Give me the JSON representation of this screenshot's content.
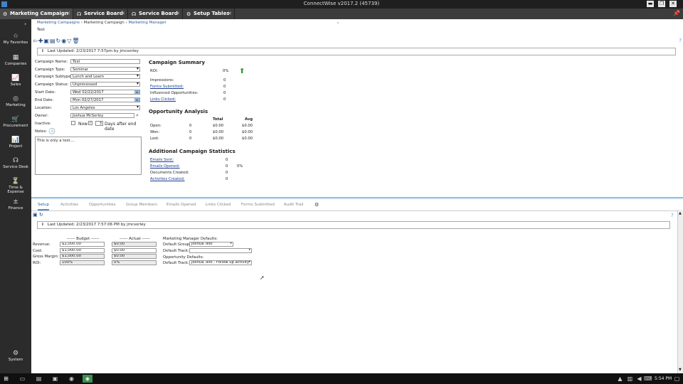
{
  "window": {
    "title": "ConnectWise v2017.2 (45739)",
    "minimize": "▬",
    "restore": "❐",
    "close": "✕"
  },
  "tabs": [
    {
      "label": "Marketing Campaign",
      "icon": "gear-icon"
    },
    {
      "label": "Service Board",
      "icon": "headset-icon"
    },
    {
      "label": "Service Board",
      "icon": "headset-icon"
    },
    {
      "label": "Setup Tables",
      "icon": "gear-icon"
    }
  ],
  "nav": [
    {
      "label": "My Favorites",
      "icon": "star-icon"
    },
    {
      "label": "Companies",
      "icon": "building-icon"
    },
    {
      "label": "Sales",
      "icon": "chart-icon"
    },
    {
      "label": "Marketing",
      "icon": "target-icon"
    },
    {
      "label": "Procurement",
      "icon": "cart-icon"
    },
    {
      "label": "Project",
      "icon": "project-icon"
    },
    {
      "label": "Service Desk",
      "icon": "headset-icon"
    },
    {
      "label": "Time & Expense",
      "icon": "time-icon"
    },
    {
      "label": "Finance",
      "icon": "finance-icon"
    },
    {
      "label": "System",
      "icon": "gear-icon"
    }
  ],
  "breadcrumb": {
    "c1": "Marketing Campaigns",
    "c2": "Marketing Campaign",
    "c3": "Marketing Manager",
    "sep": "›"
  },
  "subtitle": "Test",
  "info_top": "Last Updated: 2/23/2017 7:57pm by jmcsorley",
  "form": {
    "name_label": "Campaign Name:",
    "name": "Test",
    "type_label": "Campaign Type:",
    "type": "Seminar",
    "subtype_label": "Campaign Subtype:",
    "subtype": "Lunch and Learn",
    "status_label": "Campaign Status:",
    "status": "Unprocessed",
    "start_label": "Start Date:",
    "start": "Wed 02/22/2017",
    "end_label": "End Date:",
    "end": "Mon 02/27/2017",
    "location_label": "Location:",
    "location": "Los Angeles",
    "owner_label": "Owner:",
    "owner": "Joshua McSorley",
    "inactive_label": "Inactive:",
    "now_label": "Now",
    "days": "3",
    "days_label": "Days after end date",
    "notes_label": "Notes:",
    "notes": "This is only a test...."
  },
  "summary": {
    "title": "Campaign Summary",
    "roi_label": "ROI:",
    "roi": "0%",
    "impressions_label": "Impressions:",
    "impressions": "0",
    "forms_label": "Forms Submitted:",
    "forms": "0",
    "influenced_label": "Influenced Opportunities:",
    "influenced": "0",
    "links_label": "Links Clicked:",
    "links": "0"
  },
  "opportunity": {
    "title": "Opportunity Analysis",
    "h_total": "Total",
    "h_avg": "Avg",
    "rows": [
      {
        "label": "Open:",
        "count": "0",
        "total": "$0.00",
        "avg": "$0.00"
      },
      {
        "label": "Won:",
        "count": "0",
        "total": "$0.00",
        "avg": "$0.00"
      },
      {
        "label": "Lost:",
        "count": "0",
        "total": "$0.00",
        "avg": "$0.00"
      }
    ]
  },
  "additional": {
    "title": "Additional Campaign Statistics",
    "sent_label": "Emails Sent:",
    "sent": "0",
    "opened_label": "Emails Opened:",
    "opened": "0",
    "opened_pct": "0%",
    "docs_label": "Documents Created:",
    "docs": "0",
    "acts_label": "Activities Created:",
    "acts": "0"
  },
  "bottom_tabs": [
    "Setup",
    "Activities",
    "Opportunities",
    "Group Members",
    "Emails Opened",
    "Links Clicked",
    "Forms Submitted",
    "Audit Trail"
  ],
  "info_bottom": "Last Updated: 2/23/2017 7:57:06 PM by jmcsorley",
  "setup": {
    "budget_h": "------ Budget ------",
    "actual_h": "------ Actual ------",
    "revenue_label": "Revenue:",
    "revenue_b": "$2,000.00",
    "revenue_a": "$0.00",
    "cost_label": "Cost:",
    "cost_b": "$1,000.00",
    "cost_a": "$0.00",
    "margin_label": "Gross Margin:",
    "margin_b": "$1,000.00",
    "margin_a": "$0.00",
    "roi_label": "ROI:",
    "roi_b": "100%",
    "roi_a": "0%",
    "mm_label": "Marketing Manager Defaults:",
    "group_label": "Default Group:",
    "group": "Joshua Test",
    "track_label": "Default Track:",
    "track": "",
    "opp_label": "Opportunity Defaults:",
    "track2_label": "Default Track:",
    "track2": "Joshua Test - Follow up activity"
  },
  "taskbar": {
    "time": "5:54 PM"
  }
}
